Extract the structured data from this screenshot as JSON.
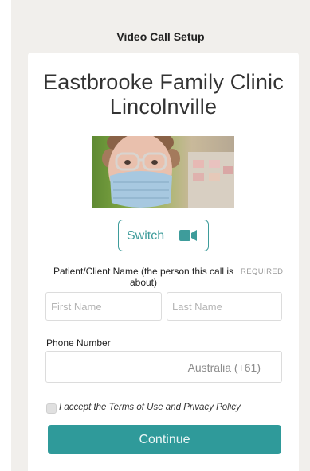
{
  "header": {
    "title": "Video Call Setup"
  },
  "clinic": {
    "name": "Eastbrooke Family Clinic",
    "location": "Lincolnville"
  },
  "camera": {
    "switch_label": "Switch",
    "icon": "video-camera-icon"
  },
  "patient": {
    "label": "Patient/Client Name (the person this call is about)",
    "required": "REQUIRED",
    "first_name_placeholder": "First Name",
    "last_name_placeholder": "Last Name"
  },
  "phone": {
    "label": "Phone Number",
    "country": "Australia (+61)"
  },
  "terms": {
    "prefix": "I accept the Terms of Use and",
    "link": "Privacy Policy"
  },
  "actions": {
    "continue_label": "Continue"
  },
  "colors": {
    "accent": "#2f9a9a",
    "background": "#f1efec"
  }
}
